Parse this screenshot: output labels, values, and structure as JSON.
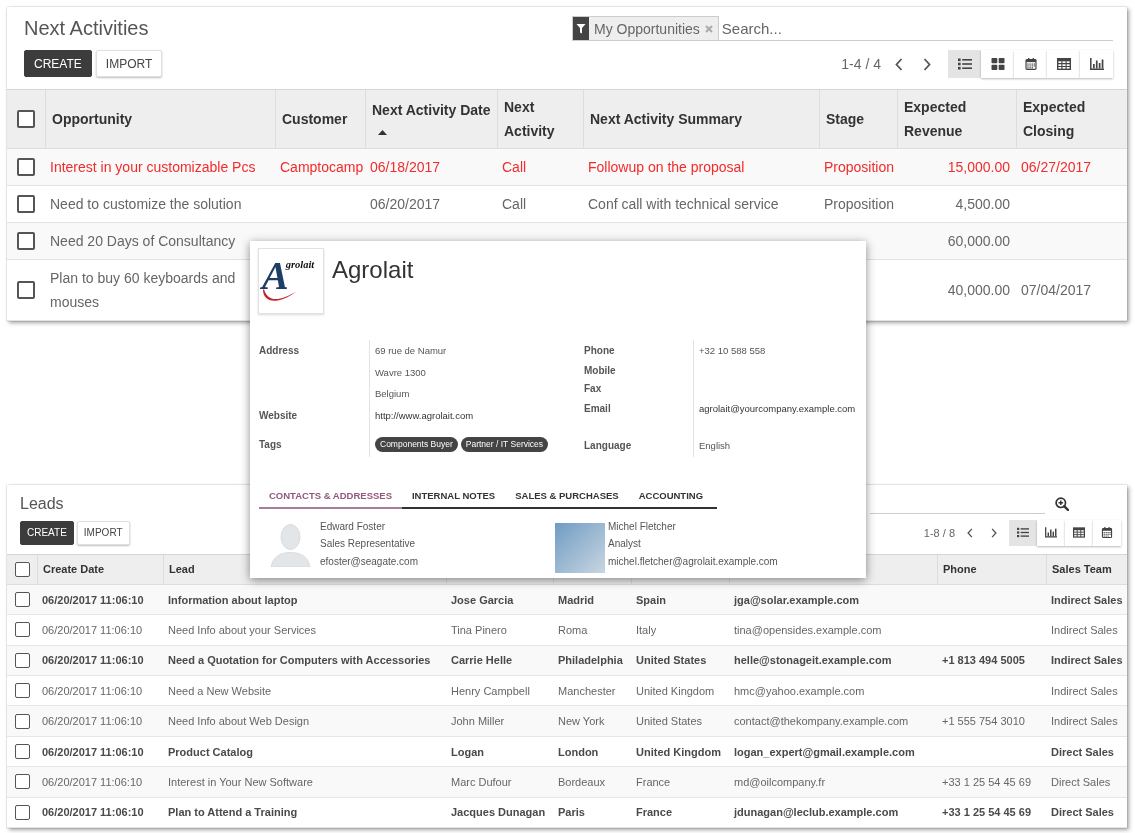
{
  "next_activities": {
    "title": "Next Activities",
    "buttons": [
      {
        "label": "CREATE",
        "kind": "primary"
      },
      {
        "label": "IMPORT",
        "kind": "secondary"
      }
    ],
    "search": {
      "facet": "My Opportunities",
      "placeholder": "Search..."
    },
    "pager": "1-4 / 4",
    "views": [
      {
        "kind": "list",
        "selected": true
      },
      {
        "kind": "kanban",
        "selected": false
      },
      {
        "kind": "calendar",
        "selected": false
      },
      {
        "kind": "pivot",
        "selected": false
      },
      {
        "kind": "graph",
        "selected": false
      }
    ],
    "table": {
      "select_all_checked": false,
      "columns": [
        {
          "label": "Opportunity",
          "sorted": false
        },
        {
          "label": "Customer",
          "sorted": false
        },
        {
          "label": "Next Activity Date",
          "sorted": true
        },
        {
          "label": "Next Activity",
          "sorted": false
        },
        {
          "label": "Next Activity Summary",
          "sorted": false
        },
        {
          "label": "Stage",
          "sorted": false
        },
        {
          "label": "Expected Revenue",
          "sorted": false
        },
        {
          "label": "Expected Closing",
          "sorted": false
        }
      ],
      "rows": [
        {
          "checked": false,
          "overdue": true,
          "opportunity": "Interest in your customizable Pcs",
          "customer": "Camptocamp",
          "next_activity_date": "06/18/2017",
          "next_activity": "Call",
          "next_activity_summary": "Followup on the proposal",
          "stage": "Proposition",
          "expected_revenue": "15,000.00",
          "expected_closing": "06/27/2017"
        },
        {
          "checked": false,
          "overdue": false,
          "opportunity": "Need to customize the solution",
          "next_activity_date": "06/20/2017",
          "next_activity": "Call",
          "next_activity_summary": "Conf call with technical service",
          "stage": "Proposition",
          "expected_revenue": "4,500.00"
        },
        {
          "checked": false,
          "overdue": false,
          "opportunity": "Need 20 Days of Consultancy",
          "expected_revenue": "60,000.00"
        },
        {
          "checked": false,
          "overdue": false,
          "opportunity": "Plan to buy 60 keyboards and mouses",
          "expected_revenue": "40,000.00",
          "expected_closing": "07/04/2017"
        }
      ]
    }
  },
  "contact_card": {
    "logo": {
      "text": "Agrolait"
    },
    "name": "Agrolait",
    "fields_left": [
      {
        "kind": "address",
        "label": "Address",
        "lines": [
          "69 rue de Namur",
          "Wavre  1300",
          "Belgium"
        ]
      },
      {
        "kind": "link",
        "label": "Website",
        "value": "http://www.agrolait.com"
      },
      {
        "kind": "tags",
        "label": "Tags",
        "tags": [
          "Components Buyer",
          "Partner / IT Services"
        ]
      }
    ],
    "fields_right": [
      {
        "kind": "text",
        "label": "Phone",
        "value": "+32 10 588 558"
      },
      {
        "kind": "text",
        "label": "Mobile"
      },
      {
        "kind": "text",
        "label": "Fax"
      },
      {
        "kind": "link",
        "label": "Email",
        "value": "agrolait@yourcompany.example.com"
      },
      {
        "kind": "text",
        "label": "Language",
        "value": "English"
      }
    ],
    "tabs": [
      {
        "label": "CONTACTS & ADDRESSES",
        "selected": true
      },
      {
        "label": "INTERNAL NOTES",
        "selected": false
      },
      {
        "label": "SALES & PURCHASES",
        "selected": false
      },
      {
        "label": "ACCOUNTING",
        "selected": false
      }
    ],
    "contacts": [
      {
        "kind": "silhouette",
        "name": "Edward Foster",
        "role": "Sales Representative",
        "email": "efoster@seagate.com"
      },
      {
        "kind": "photo",
        "name": "Michel Fletcher",
        "role": "Analyst",
        "email": "michel.fletcher@agrolait.example.com"
      }
    ]
  },
  "leads": {
    "title": "Leads",
    "buttons": [
      {
        "label": "CREATE",
        "kind": "primary"
      },
      {
        "label": "IMPORT",
        "kind": "secondary"
      }
    ],
    "pager": "1-8 / 8",
    "views": [
      {
        "kind": "list",
        "selected": true
      },
      {
        "kind": "graph",
        "selected": false
      },
      {
        "kind": "pivot",
        "selected": false
      },
      {
        "kind": "calendar",
        "selected": false
      }
    ],
    "table": {
      "select_all_checked": false,
      "header": {
        "create_date": "Create Date",
        "lead": "Lead",
        "phone": "Phone",
        "sales_team": "Sales Team"
      },
      "rows": [
        {
          "checked": false,
          "bold": true,
          "create_date": "06/20/2017 11:06:10",
          "lead": "Information about laptop",
          "column_3": "Jose Garcia",
          "column_4": "Madrid",
          "column_5": "Spain",
          "column_6": "jga@solar.example.com",
          "sales_team": "Indirect Sales"
        },
        {
          "checked": false,
          "bold": false,
          "create_date": "06/20/2017 11:06:10",
          "lead": "Need Info about your Services",
          "column_3": "Tina Pinero",
          "column_4": "Roma",
          "column_5": "Italy",
          "column_6": "tina@opensides.example.com",
          "sales_team": "Indirect Sales"
        },
        {
          "checked": false,
          "bold": true,
          "create_date": "06/20/2017 11:06:10",
          "lead": "Need a Quotation for Computers with Accessories",
          "column_3": "Carrie Helle",
          "column_4": "Philadelphia",
          "column_5": "United States",
          "column_6": "helle@stonageit.example.com",
          "phone": "+1 813 494 5005",
          "sales_team": "Indirect Sales"
        },
        {
          "checked": false,
          "bold": false,
          "create_date": "06/20/2017 11:06:10",
          "lead": "Need a New Website",
          "column_3": "Henry Campbell",
          "column_4": "Manchester",
          "column_5": "United Kingdom",
          "column_6": "hmc@yahoo.example.com",
          "sales_team": "Indirect Sales"
        },
        {
          "checked": false,
          "bold": false,
          "create_date": "06/20/2017 11:06:10",
          "lead": "Need Info about Web Design",
          "column_3": "John Miller",
          "column_4": "New York",
          "column_5": "United States",
          "column_6": "contact@thekompany.example.com",
          "phone": "+1 555 754 3010",
          "sales_team": "Indirect Sales"
        },
        {
          "checked": false,
          "bold": true,
          "create_date": "06/20/2017 11:06:10",
          "lead": "Product Catalog",
          "column_3": "Logan",
          "column_4": "London",
          "column_5": "United Kingdom",
          "column_6": "logan_expert@gmail.example.com",
          "sales_team": "Direct Sales"
        },
        {
          "checked": false,
          "bold": false,
          "create_date": "06/20/2017 11:06:10",
          "lead": "Interest in Your New Software",
          "column_3": "Marc Dufour",
          "column_4": "Bordeaux",
          "column_5": "France",
          "column_6": "md@oilcompany.fr",
          "phone": "+33 1 25 54 45 69",
          "sales_team": "Direct Sales"
        },
        {
          "checked": false,
          "bold": true,
          "create_date": "06/20/2017 11:06:10",
          "lead": "Plan to Attend a Training",
          "column_3": "Jacques Dunagan",
          "column_4": "Paris",
          "column_5": "France",
          "column_6": "jdunagan@leclub.example.com",
          "phone": "+33 1 25 54 45 69",
          "sales_team": "Direct Sales"
        }
      ]
    }
  }
}
